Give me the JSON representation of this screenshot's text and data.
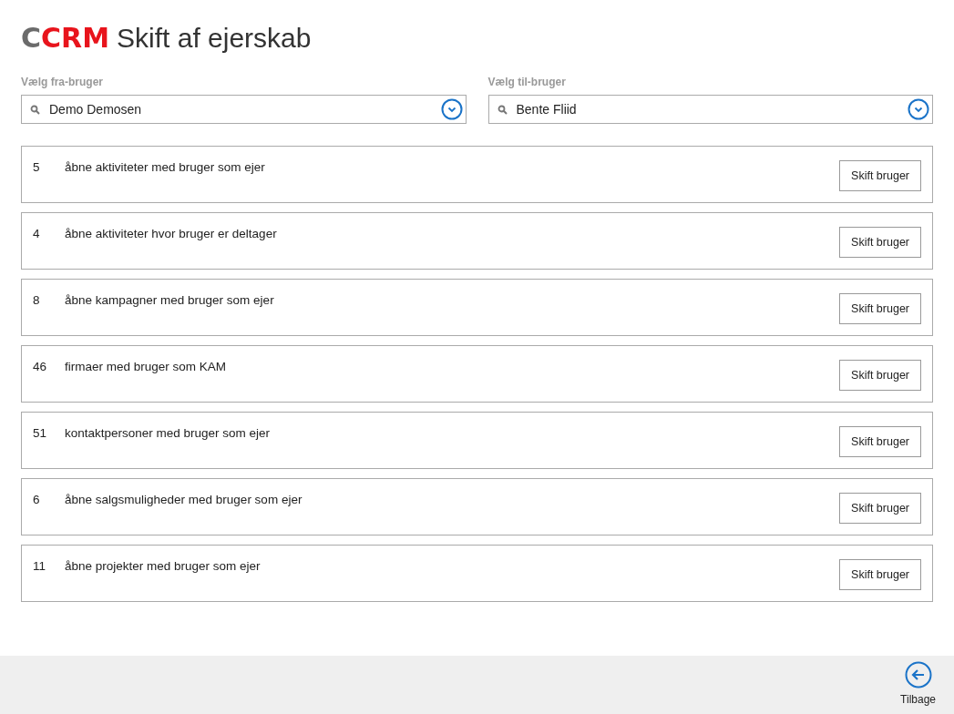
{
  "header": {
    "logo": [
      {
        "text": "C",
        "color": "#6b6b6b"
      },
      {
        "text": "CRM",
        "color": "#e8141c"
      }
    ],
    "title": "Skift af ejerskab"
  },
  "pickers": [
    {
      "label": "Vælg fra-bruger",
      "value": "Demo Demosen"
    },
    {
      "label": "Vælg til-bruger",
      "value": "Bente Fliid"
    }
  ],
  "items": [
    {
      "count": "5",
      "text": "åbne aktiviteter med bruger som ejer",
      "button": "Skift bruger"
    },
    {
      "count": "4",
      "text": "åbne aktiviteter hvor bruger er deltager",
      "button": "Skift bruger"
    },
    {
      "count": "8",
      "text": "åbne kampagner med bruger som ejer",
      "button": "Skift bruger"
    },
    {
      "count": "46",
      "text": "firmaer med bruger som KAM",
      "button": "Skift bruger"
    },
    {
      "count": "51",
      "text": "kontaktpersoner med bruger som ejer",
      "button": "Skift bruger"
    },
    {
      "count": "6",
      "text": "åbne salgsmuligheder med bruger som ejer",
      "button": "Skift bruger"
    },
    {
      "count": "11",
      "text": "åbne projekter med bruger som ejer",
      "button": "Skift bruger"
    }
  ],
  "footer": {
    "back_label": "Tilbage"
  }
}
